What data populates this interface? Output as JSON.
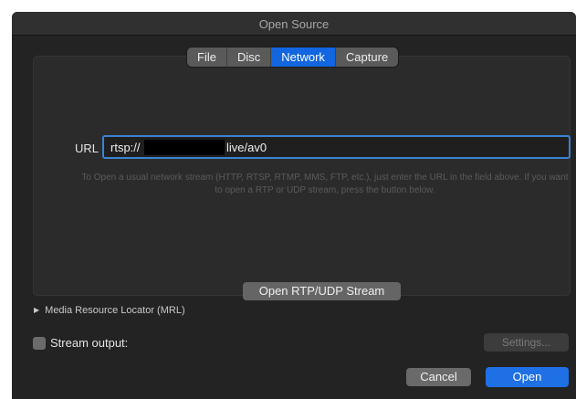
{
  "window": {
    "title": "Open Source"
  },
  "tabs": [
    {
      "label": "File",
      "active": false
    },
    {
      "label": "Disc",
      "active": false
    },
    {
      "label": "Network",
      "active": true
    },
    {
      "label": "Capture",
      "active": false
    }
  ],
  "network": {
    "url_label": "URL",
    "url_value_prefix": "rtsp://",
    "url_value_suffix": "live/av0",
    "help_text": "To Open a usual network stream (HTTP, RTSP, RTMP, MMS, FTP, etc.), just enter the URL in the field above. If you want to open a RTP or UDP stream, press the button below.",
    "rtp_button_label": "Open RTP/UDP Stream"
  },
  "mrl": {
    "label": "Media Resource Locator (MRL)"
  },
  "stream_output": {
    "label": "Stream output:",
    "checked": false,
    "settings_label": "Settings..."
  },
  "footer": {
    "cancel_label": "Cancel",
    "open_label": "Open"
  },
  "colors": {
    "accent": "#1f6fe5",
    "window_bg": "#232323",
    "focus_ring": "#3b82d4"
  }
}
